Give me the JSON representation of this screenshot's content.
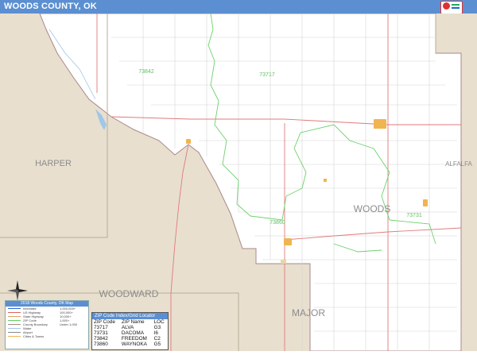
{
  "header": {
    "title": "WOODS COUNTY, OK"
  },
  "map": {
    "county_label": "WOODS",
    "neighbors": {
      "west": "HARPER",
      "east": "ALFALFA",
      "southwest": "WOODWARD",
      "south": "MAJOR"
    },
    "zip_labels": {
      "z73842": "73842",
      "z73717": "73717",
      "z73731": "73731",
      "z73860": "73860"
    },
    "colors": {
      "land_outside": "#e8dfcf",
      "county_fill": "#ffffff",
      "river": "#9ec7e8",
      "zip_boundary": "#5fd05f",
      "roads_major": "#e06060",
      "roads_minor": "#cfcfcf",
      "cities": "#e8a94a"
    }
  },
  "legend": {
    "title": "2018 Woods County, OK Map",
    "rows": [
      "Interstate",
      "US Highway",
      "State Highway",
      "ZIP Code",
      "County Boundary",
      "Water",
      "Airport",
      "Cities & Towns"
    ],
    "right_rows": [
      "1,000,000+",
      "100,000+",
      "10,000+",
      "1,000+",
      "Under 1,000"
    ]
  },
  "zip_index": {
    "title": "ZIP Code Index/Grid Locator",
    "headers": [
      "ZIP Code",
      "ZIP Name",
      "LOC"
    ],
    "rows": [
      [
        "73717",
        "ALVA",
        "G3"
      ],
      [
        "73731",
        "DACOMA",
        "I6"
      ],
      [
        "73842",
        "FREEDOM",
        "C2"
      ],
      [
        "73860",
        "WAYNOKA",
        "G5"
      ]
    ]
  }
}
